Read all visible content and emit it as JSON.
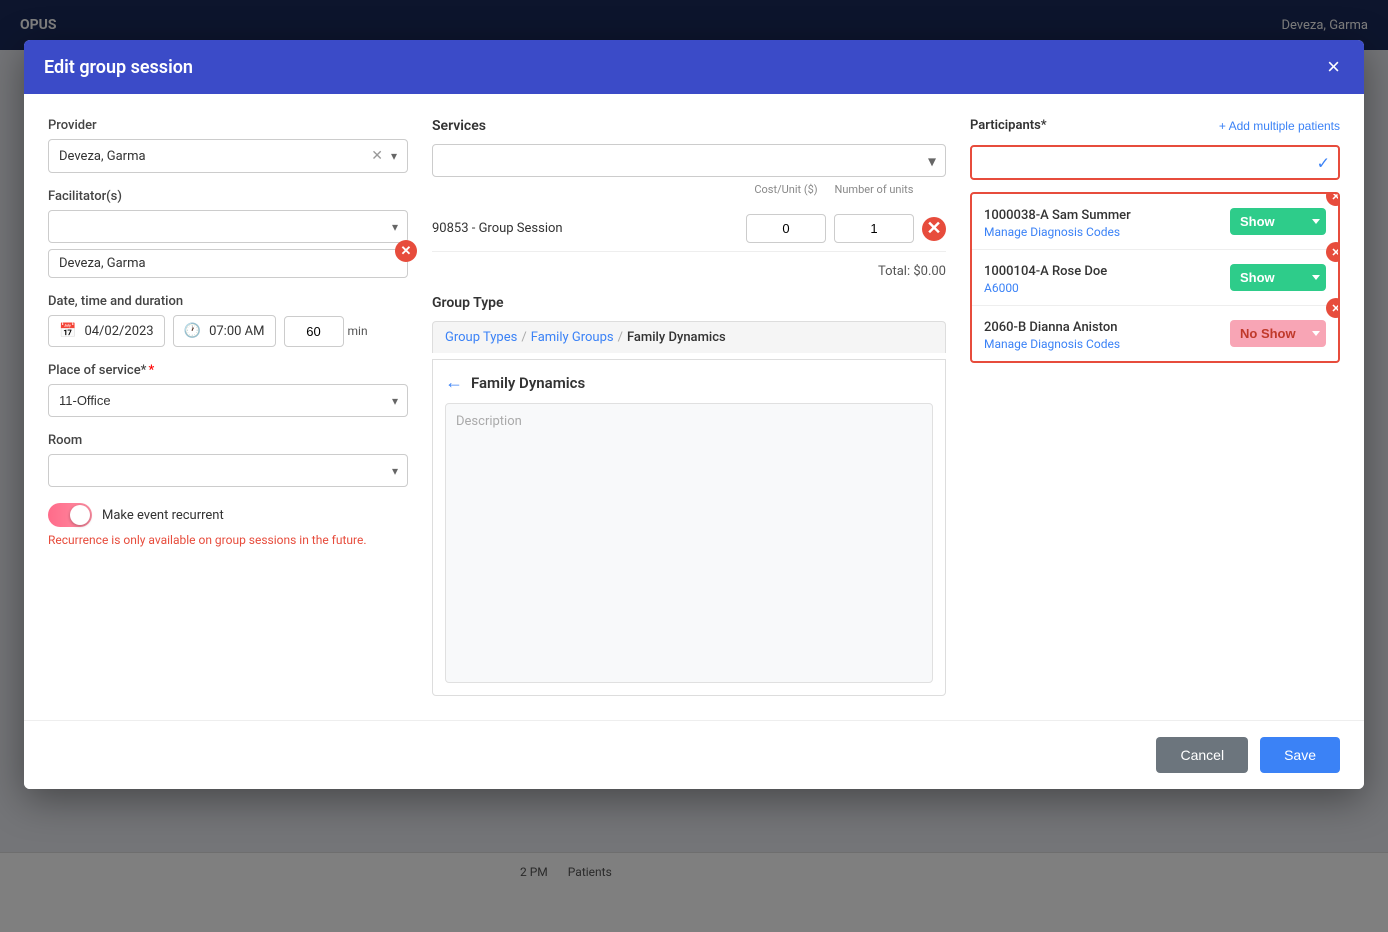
{
  "modal": {
    "title": "Edit group session",
    "close_label": "×"
  },
  "provider": {
    "label": "Provider",
    "value": "Deveza, Garma"
  },
  "facilitators": {
    "label": "Facilitator(s)",
    "tag": "Deveza, Garma"
  },
  "datetime": {
    "label": "Date, time and duration",
    "date": "04/02/2023",
    "time": "07:00 AM",
    "duration": "60",
    "duration_unit": "min"
  },
  "place_of_service": {
    "label": "Place of service*",
    "value": "11-Office"
  },
  "room": {
    "label": "Room"
  },
  "recurrent": {
    "label": "Make event recurrent",
    "warning": "Recurrence is only available on group sessions in the future."
  },
  "services": {
    "label": "Services",
    "rows": [
      {
        "code": "90853 - Group Session",
        "cost": "0",
        "units": "1"
      }
    ],
    "total": "Total: $0.00"
  },
  "group_type": {
    "label": "Group Type",
    "breadcrumb": [
      {
        "text": "Group Types",
        "active": false
      },
      {
        "text": "Family Groups",
        "active": false
      },
      {
        "text": "Family Dynamics",
        "active": true
      }
    ],
    "title": "Family Dynamics",
    "description_placeholder": "Description"
  },
  "participants": {
    "label": "Participants*",
    "add_multiple_label": "+ Add multiple patients",
    "list": [
      {
        "id": "1000038-A Sam Summer",
        "sub_label": "Manage Diagnosis Codes",
        "status": "Show",
        "status_class": "status-show"
      },
      {
        "id": "1000104-A Rose Doe",
        "sub_label": "A6000",
        "status": "Show",
        "status_class": "status-show"
      },
      {
        "id": "2060-B Dianna Aniston",
        "sub_label": "Manage Diagnosis Codes",
        "status": "No Show",
        "status_class": "status-noshow"
      }
    ]
  },
  "footer": {
    "cancel_label": "Cancel",
    "save_label": "Save"
  }
}
